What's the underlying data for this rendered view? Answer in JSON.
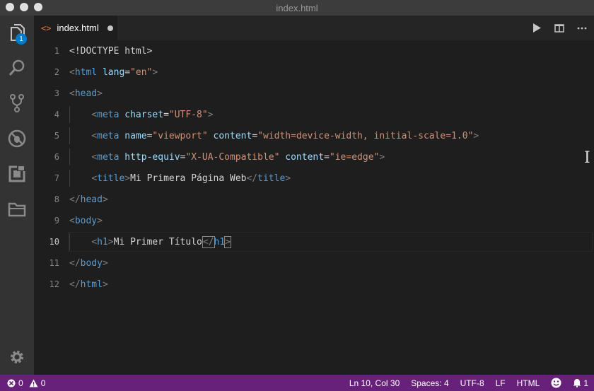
{
  "window": {
    "title": "index.html"
  },
  "activity_bar": {
    "items": [
      {
        "icon": "explorer-icon",
        "badge": "1"
      },
      {
        "icon": "search-icon"
      },
      {
        "icon": "source-control-icon"
      },
      {
        "icon": "debug-icon"
      },
      {
        "icon": "extensions-icon"
      },
      {
        "icon": "folder-icon"
      }
    ],
    "settings_icon": "gear-icon"
  },
  "tab": {
    "label": "index.html",
    "icon": "html-file-icon",
    "dirty": true
  },
  "tab_actions": [
    "run-icon",
    "split-editor-icon",
    "more-icon"
  ],
  "editor": {
    "line_numbers": [
      "1",
      "2",
      "3",
      "4",
      "5",
      "6",
      "7",
      "8",
      "9",
      "10",
      "11",
      "12"
    ],
    "active_line": "10",
    "lines": [
      [
        {
          "c": "txt",
          "t": "<!DOCTYPE html>"
        }
      ],
      [
        {
          "c": "punc",
          "t": "<"
        },
        {
          "c": "tag",
          "t": "html"
        },
        {
          "c": "txt",
          "t": " "
        },
        {
          "c": "attr",
          "t": "lang"
        },
        {
          "c": "txt",
          "t": "="
        },
        {
          "c": "str",
          "t": "\"en\""
        },
        {
          "c": "punc",
          "t": ">"
        }
      ],
      [
        {
          "c": "punc",
          "t": "<"
        },
        {
          "c": "tag",
          "t": "head"
        },
        {
          "c": "punc",
          "t": ">"
        }
      ],
      [
        {
          "c": "txt",
          "t": "    "
        },
        {
          "c": "punc",
          "t": "<"
        },
        {
          "c": "tag",
          "t": "meta"
        },
        {
          "c": "txt",
          "t": " "
        },
        {
          "c": "attr",
          "t": "charset"
        },
        {
          "c": "txt",
          "t": "="
        },
        {
          "c": "str",
          "t": "\"UTF-8\""
        },
        {
          "c": "punc",
          "t": ">"
        }
      ],
      [
        {
          "c": "txt",
          "t": "    "
        },
        {
          "c": "punc",
          "t": "<"
        },
        {
          "c": "tag",
          "t": "meta"
        },
        {
          "c": "txt",
          "t": " "
        },
        {
          "c": "attr",
          "t": "name"
        },
        {
          "c": "txt",
          "t": "="
        },
        {
          "c": "str",
          "t": "\"viewport\""
        },
        {
          "c": "txt",
          "t": " "
        },
        {
          "c": "attr",
          "t": "content"
        },
        {
          "c": "txt",
          "t": "="
        },
        {
          "c": "str",
          "t": "\"width=device-width, initial-scale=1.0\""
        },
        {
          "c": "punc",
          "t": ">"
        }
      ],
      [
        {
          "c": "txt",
          "t": "    "
        },
        {
          "c": "punc",
          "t": "<"
        },
        {
          "c": "tag",
          "t": "meta"
        },
        {
          "c": "txt",
          "t": " "
        },
        {
          "c": "attr",
          "t": "http-equiv"
        },
        {
          "c": "txt",
          "t": "="
        },
        {
          "c": "str",
          "t": "\"X-UA-Compatible\""
        },
        {
          "c": "txt",
          "t": " "
        },
        {
          "c": "attr",
          "t": "content"
        },
        {
          "c": "txt",
          "t": "="
        },
        {
          "c": "str",
          "t": "\"ie=edge\""
        },
        {
          "c": "punc",
          "t": ">"
        }
      ],
      [
        {
          "c": "txt",
          "t": "    "
        },
        {
          "c": "punc",
          "t": "<"
        },
        {
          "c": "tag",
          "t": "title"
        },
        {
          "c": "punc",
          "t": ">"
        },
        {
          "c": "txt",
          "t": "Mi Primera Página Web"
        },
        {
          "c": "punc",
          "t": "</"
        },
        {
          "c": "tag",
          "t": "title"
        },
        {
          "c": "punc",
          "t": ">"
        }
      ],
      [
        {
          "c": "punc",
          "t": "</"
        },
        {
          "c": "tag",
          "t": "head"
        },
        {
          "c": "punc",
          "t": ">"
        }
      ],
      [
        {
          "c": "punc",
          "t": "<"
        },
        {
          "c": "tag",
          "t": "body"
        },
        {
          "c": "punc",
          "t": ">"
        }
      ],
      [
        {
          "c": "txt",
          "t": "    "
        },
        {
          "c": "punc",
          "t": "<"
        },
        {
          "c": "tag",
          "t": "h1"
        },
        {
          "c": "punc",
          "t": ">"
        },
        {
          "c": "txt",
          "t": "Mi Primer Título"
        },
        {
          "c": "cursor",
          "t": ""
        },
        {
          "c": "punc hl",
          "t": "</"
        },
        {
          "c": "tag",
          "t": "h1"
        },
        {
          "c": "punc hl",
          "t": ">"
        }
      ],
      [
        {
          "c": "punc",
          "t": "</"
        },
        {
          "c": "tag",
          "t": "body"
        },
        {
          "c": "punc",
          "t": ">"
        }
      ],
      [
        {
          "c": "punc",
          "t": "</"
        },
        {
          "c": "tag",
          "t": "html"
        },
        {
          "c": "punc",
          "t": ">"
        }
      ]
    ]
  },
  "status_bar": {
    "errors": "0",
    "warnings": "0",
    "position": "Ln 10, Col 30",
    "indent": "Spaces: 4",
    "encoding": "UTF-8",
    "eol": "LF",
    "language": "HTML",
    "notifications": "1",
    "color": "#68217a"
  }
}
